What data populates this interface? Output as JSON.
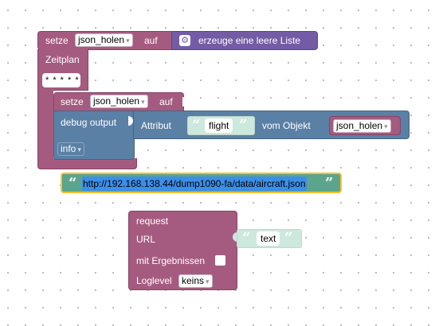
{
  "blocks": {
    "set_outer": {
      "keyword": "setze",
      "variable": "json_holen",
      "suffix": "auf"
    },
    "create_list": {
      "label": "erzeuge eine leere Liste"
    },
    "schedule": {
      "label": "Zeitplan",
      "pattern": "* * * * *"
    },
    "set_inner": {
      "keyword": "setze",
      "variable": "json_holen",
      "suffix": "auf"
    },
    "debug": {
      "label": "debug output",
      "level": "info"
    },
    "attribute": {
      "label": "Attribut",
      "value": "flight",
      "from_object_label": "vom Objekt",
      "object_variable": "json_holen"
    },
    "url_text": {
      "value": "http://192.168.138.44/dump1090-fa/data/aircraft.json"
    },
    "request": {
      "label": "request",
      "url_label": "URL",
      "url_value": "text",
      "with_results_label": "mit Ergebnissen",
      "loglevel_label": "Loglevel",
      "loglevel_value": "keins"
    }
  },
  "colors": {
    "procedure": "#a55b80",
    "debug": "#5b80a5",
    "list": "#745ba5",
    "text": "#5ba58c",
    "selected_outline": "#fbc02d"
  },
  "icons": {
    "list_gear": "gear-icon",
    "dropdown": "chevron-down-icon",
    "quote": "quote-icon"
  }
}
